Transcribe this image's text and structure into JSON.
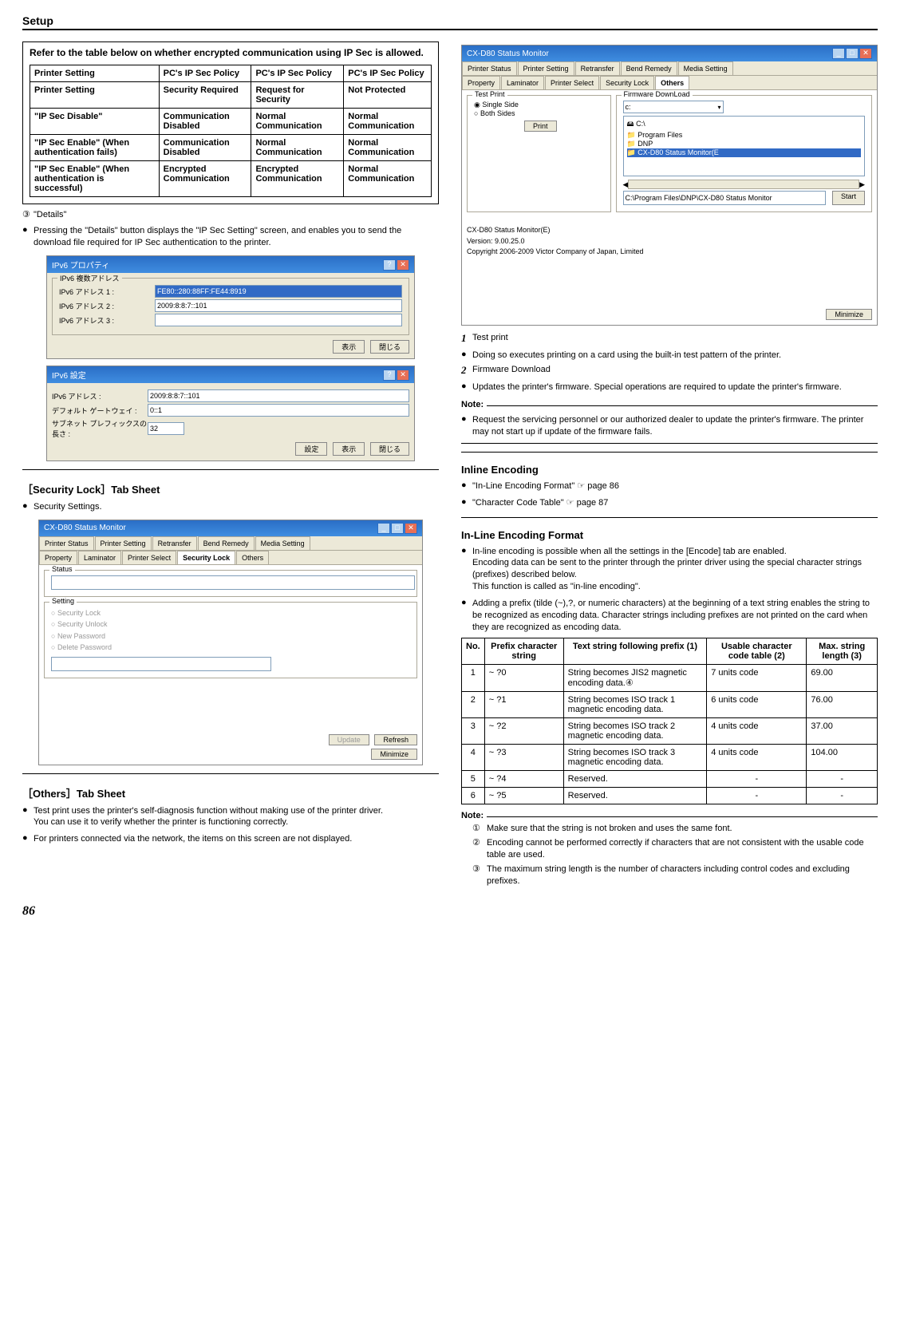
{
  "header": "Setup",
  "left": {
    "box_title": "Refer to the table below on whether encrypted communication using IP Sec is allowed.",
    "ipsec_headers": [
      "Printer Setting",
      "PC's IP Sec Policy",
      "PC's IP Sec Policy",
      "PC's IP Sec Policy"
    ],
    "ipsec_rows": [
      [
        "Printer Setting",
        "Security Required",
        "Request for Security",
        "Not Protected"
      ],
      [
        "\"IP Sec Disable\"",
        "Communication Disabled",
        "Normal Communication",
        "Normal Communication"
      ],
      [
        "\"IP Sec Enable\" (When authentication fails)",
        "Communication Disabled",
        "Normal Communication",
        "Normal Communication"
      ],
      [
        "\"IP Sec Enable\" (When authentication is successful)",
        "Encrypted Communication",
        "Encrypted Communication",
        "Normal Communication"
      ]
    ],
    "details_marker": "③",
    "details_label": "\"Details\"",
    "details_text": "Pressing the \"Details\" button displays the \"IP Sec Setting\" screen, and enables you to send the download file required for IP Sec authentication to the printer.",
    "dlg1": {
      "title": "IPv6 プロパティ",
      "group": "IPv6 複数アドレス",
      "row1_label": "IPv6 アドレス 1 :",
      "row1_val": "FE80::280:88FF:FE44:8919",
      "row2_label": "IPv6 アドレス 2 :",
      "row2_val": "2009:8:8:7::101",
      "row3_label": "IPv6 アドレス 3 :",
      "row3_val": "",
      "btn_show": "表示",
      "btn_close": "閉じる"
    },
    "dlg2": {
      "title": "IPv6 設定",
      "row1_label": "IPv6 アドレス :",
      "row1_val": "2009:8:8:7::101",
      "row2_label": "デフォルト ゲートウェイ :",
      "row2_val": "0::1",
      "row3_label": "サブネット プレフィックスの長さ :",
      "row3_val": "32",
      "btn_set": "設定",
      "btn_show": "表示",
      "btn_close": "閉じる"
    },
    "seclock_heading": "［Security Lock］Tab Sheet",
    "seclock_text": "Security Settings.",
    "seclock_win": {
      "title": "CX-D80 Status Monitor",
      "tabs_top": [
        "Printer Status",
        "Printer Setting",
        "Retransfer",
        "Bend Remedy",
        "Media Setting"
      ],
      "tabs_bot": [
        "Property",
        "Laminator",
        "Printer Select",
        "Security Lock",
        "Others"
      ],
      "status_label": "Status",
      "setting_label": "Setting",
      "radios": [
        "Security Lock",
        "Security Unlock",
        "New Password",
        "Delete Password"
      ],
      "btn_update": "Update",
      "btn_refresh": "Refresh",
      "btn_minimize": "Minimize"
    },
    "others_heading": "［Others］Tab Sheet",
    "others_b1": "Test print uses the printer's self-diagnosis function without making use of the printer driver.\nYou can use it to verify whether the printer is functioning correctly.",
    "others_b2": "For printers connected via the network, the items on this screen are not displayed."
  },
  "right": {
    "others_win": {
      "title": "CX-D80 Status Monitor",
      "tabs_top": [
        "Printer Status",
        "Printer Setting",
        "Retransfer",
        "Bend Remedy",
        "Media Setting"
      ],
      "tabs_bot": [
        "Property",
        "Laminator",
        "Printer Select",
        "Security Lock",
        "Others"
      ],
      "testprint_label": "Test Print",
      "radio_single": "Single Side",
      "radio_both": "Both Sides",
      "btn_print": "Print",
      "fw_label": "Firmware DownLoad",
      "drive_sel": "c:",
      "tree_rows": [
        "🖴 C:\\",
        "📁 Program Files",
        "📁 DNP",
        "📁 CX-D80 Status Monitor(E"
      ],
      "path_val": "C:\\Program Files\\DNP\\CX-D80 Status Monitor",
      "btn_start": "Start",
      "ver_line1": "CX-D80 Status Monitor(E)",
      "ver_line2": "Version: 9.00.25.0",
      "ver_line3": "Copyright 2006-2009 Victor Company of Japan, Limited",
      "btn_minimize": "Minimize"
    },
    "item1_num": "1",
    "item1_label": "Test print",
    "item1_text": "Doing so executes printing on a card using the built-in test pattern of the printer.",
    "item2_num": "2",
    "item2_label": "Firmware Download",
    "item2_text": "Updates the printer's firmware. Special operations are required to update the printer's firmware.",
    "note1_label": "Note:",
    "note1_text": "Request the servicing personnel or our authorized dealer to update the printer's firmware. The printer may not start up if update of the firmware fails.",
    "inline_heading": "Inline Encoding",
    "inline_b1": "\"In-Line Encoding Format\" ☞ page 86",
    "inline_b2": "\"Character Code Table\" ☞ page 87",
    "fmt_heading": "In-Line Encoding Format",
    "fmt_b1": "In-line encoding is possible when all the settings in the [Encode] tab are enabled.\nEncoding data can be sent to the printer through the printer driver using the special character strings (prefixes) described below.\nThis function is called as \"in-line encoding\".",
    "fmt_b2": "Adding a prefix (tilde (~),?, or numeric characters) at the beginning of a text string enables the string to be recognized as encoding data. Character strings including prefixes are not printed on the card when they are recognized as encoding data.",
    "enc_headers": [
      "No.",
      "Prefix character string",
      "Text string following prefix (1)",
      "Usable character code table (2)",
      "Max. string length (3)"
    ],
    "enc_rows": [
      {
        "no": "1",
        "prefix": "~ ?0",
        "text": "String becomes JIS2 magnetic encoding data.④",
        "code": "7 units code",
        "max": "69.00"
      },
      {
        "no": "2",
        "prefix": "~ ?1",
        "text": "String becomes ISO track 1 magnetic encoding data.",
        "code": "6 units code",
        "max": "76.00"
      },
      {
        "no": "3",
        "prefix": "~ ?2",
        "text": "String becomes ISO track 2 magnetic encoding data.",
        "code": "4 units code",
        "max": "37.00"
      },
      {
        "no": "4",
        "prefix": "~ ?3",
        "text": "String becomes ISO track 3 magnetic encoding data.",
        "code": "4 units code",
        "max": "104.00"
      },
      {
        "no": "5",
        "prefix": "~ ?4",
        "text": "Reserved.",
        "code": "-",
        "max": "-"
      },
      {
        "no": "6",
        "prefix": "~ ?5",
        "text": "Reserved.",
        "code": "-",
        "max": "-"
      }
    ],
    "note2_label": "Note:",
    "note2_items": [
      {
        "m": "①",
        "t": "Make sure that the string is not broken and uses the same font."
      },
      {
        "m": "②",
        "t": "Encoding cannot be performed correctly if characters that are not consistent with the usable code table are used."
      },
      {
        "m": "③",
        "t": "The maximum string length is the number of characters including control codes and excluding prefixes."
      }
    ]
  },
  "page_number": "86"
}
